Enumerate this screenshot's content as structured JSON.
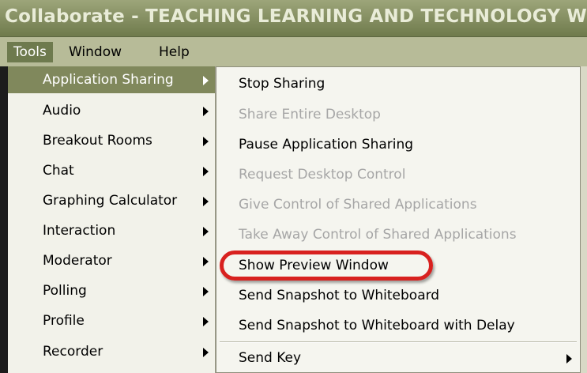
{
  "window": {
    "title": "Collaborate - TEACHING LEARNING AND TECHNOLOGY WEEK"
  },
  "menubar": {
    "items": [
      {
        "label": "Tools",
        "active": true
      },
      {
        "label": "Window",
        "active": false
      },
      {
        "label": "Help",
        "active": false
      }
    ]
  },
  "tools_menu": {
    "items": [
      {
        "label": "Application Sharing"
      },
      {
        "label": "Audio"
      },
      {
        "label": "Breakout Rooms"
      },
      {
        "label": "Chat"
      },
      {
        "label": "Graphing Calculator"
      },
      {
        "label": "Interaction"
      },
      {
        "label": "Moderator"
      },
      {
        "label": "Polling"
      },
      {
        "label": "Profile"
      },
      {
        "label": "Recorder"
      }
    ]
  },
  "sharing_submenu": {
    "items": [
      {
        "label": "Stop Sharing",
        "enabled": true
      },
      {
        "label": "Share Entire Desktop",
        "enabled": false
      },
      {
        "label": "Pause Application Sharing",
        "enabled": true
      },
      {
        "label": "Request Desktop Control",
        "enabled": false
      },
      {
        "label": "Give Control of Shared Applications",
        "enabled": false
      },
      {
        "label": "Take Away Control of Shared Applications",
        "enabled": false
      },
      {
        "label": "Show Preview Window",
        "enabled": true,
        "highlighted": true
      },
      {
        "label": "Send Snapshot to Whiteboard",
        "enabled": true
      },
      {
        "label": "Send Snapshot to Whiteboard with Delay",
        "enabled": true
      },
      {
        "label": "Send Key",
        "enabled": true
      }
    ]
  },
  "colors": {
    "title_bar": "#6f7a4c",
    "menu_active": "#80885c",
    "highlight_ring": "#d8211f",
    "disabled_text": "#a6a6a6"
  }
}
